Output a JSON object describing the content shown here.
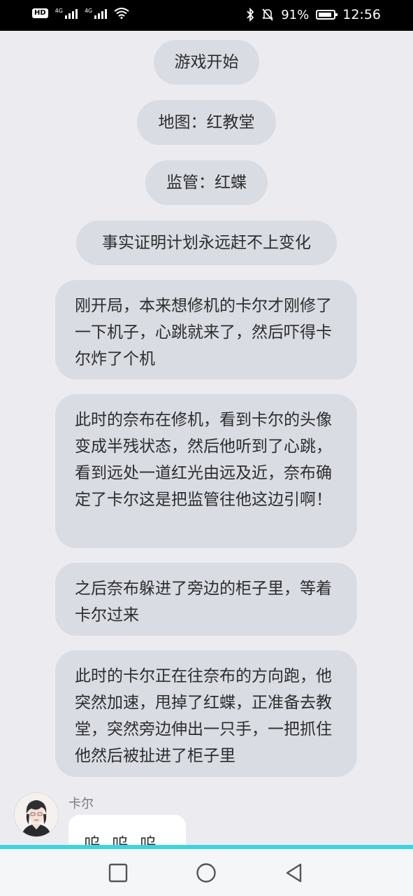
{
  "status_bar": {
    "hd": "HD",
    "sim1": "4G",
    "sim2": "4G",
    "battery_pct": "91%",
    "time": "12:56"
  },
  "messages": {
    "m1": "游戏开始",
    "m2": "地图：红教堂",
    "m3": "监管：红蝶",
    "m4": "事实证明计划永远赶不上变化",
    "m5": "刚开局，本来想修机的卡尔才刚修了一下机子，心跳就来了，然后吓得卡尔炸了个机",
    "m6": "此时的奈布在修机，看到卡尔的头像变成半残状态，然后他听到了心跳，看到远处一道红光由远及近，奈布确定了卡尔这是把监管往他这边引啊！",
    "m7": "之后奈布躲进了旁边的柜子里，等着卡尔过来",
    "m8": "此时的卡尔正在往奈布的方向跑，他突然加速，甩掉了红蝶，正准备去教堂，突然旁边伸出一只手，一把抓住他然后被扯进了柜子里"
  },
  "reply": {
    "sender": "卡尔",
    "text": "呜呜呜"
  },
  "icons": {
    "bluetooth": "bluetooth-icon",
    "mute": "bell-off-icon",
    "wifi": "wifi-icon",
    "battery": "battery-icon",
    "recent": "square-recent-apps-icon",
    "home": "circle-home-icon",
    "back": "triangle-back-icon"
  },
  "colors": {
    "background": "#ececf0",
    "bubble": "#dadce4",
    "reply_bubble": "#ffffff",
    "nav_accent": "#3fd3e0"
  }
}
